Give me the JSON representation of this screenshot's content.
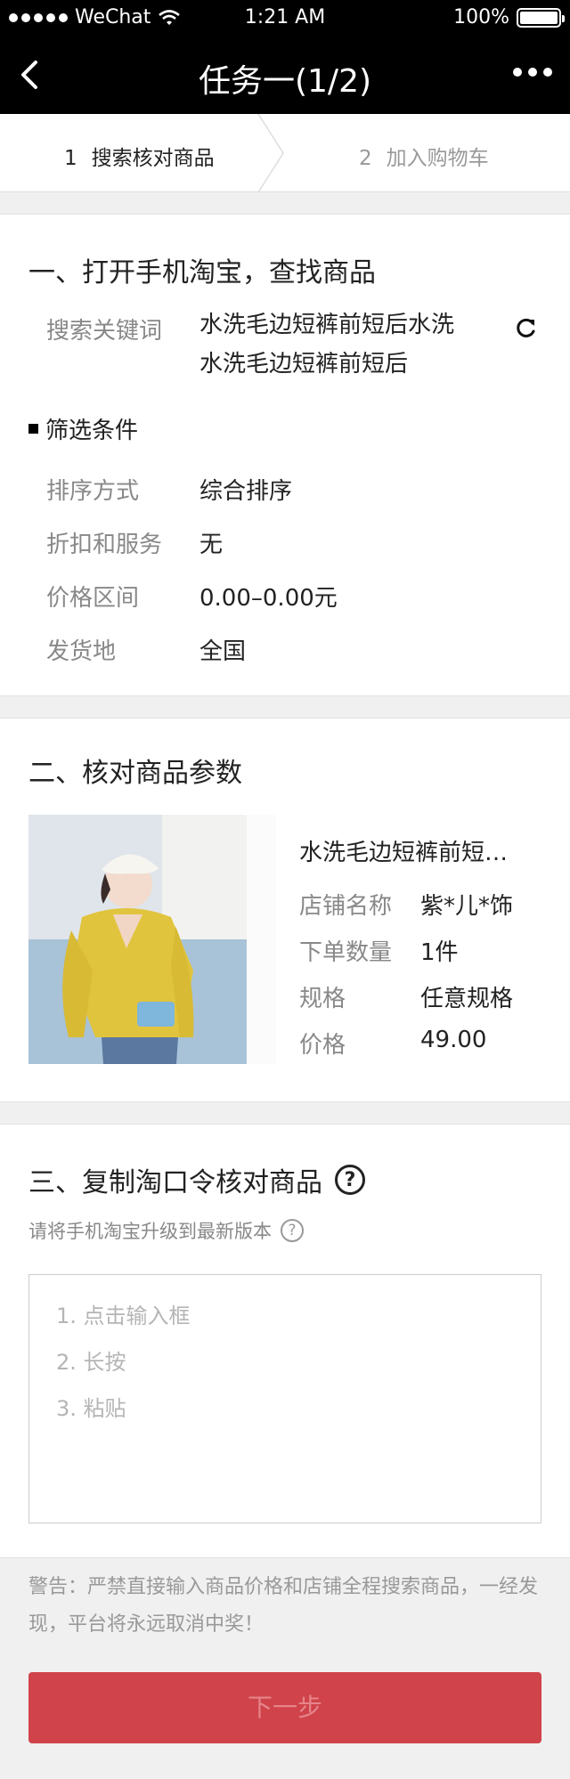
{
  "status_bar": {
    "carrier": "WeChat",
    "time": "1:21 AM",
    "battery": "100%"
  },
  "nav": {
    "title": "任务一(1/2)"
  },
  "steps": [
    {
      "num": "1",
      "label": "搜索核对商品",
      "active": true
    },
    {
      "num": "2",
      "label": "加入购物车",
      "active": false
    }
  ],
  "section1": {
    "title": "一、打开手机淘宝，查找商品",
    "keyword_label": "搜索关键词",
    "keyword_line1": "水洗毛边短裤前短后水洗",
    "keyword_line2": "水洗毛边短裤前短后",
    "filter_title": "筛选条件",
    "rows": [
      {
        "label": "排序方式",
        "value": "综合排序"
      },
      {
        "label": "折扣和服务",
        "value": "无"
      },
      {
        "label": "价格区间",
        "value": "0.00–0.00元"
      },
      {
        "label": "发货地",
        "value": "全国"
      }
    ]
  },
  "section2": {
    "title": "二、核对商品参数",
    "product_name": "水洗毛边短裤前短…",
    "params": [
      {
        "label": "店铺名称",
        "value": "紫*儿*饰"
      },
      {
        "label": "下单数量",
        "value": "1件"
      },
      {
        "label": "规格",
        "value": "任意规格"
      },
      {
        "label": "价格",
        "value": "49.00"
      }
    ]
  },
  "section3": {
    "title": "三、复制淘口令核对商品",
    "hint": "请将手机淘宝升级到最新版本",
    "placeholder_lines": [
      "1. 点击输入框",
      "2. 长按",
      "3. 粘贴"
    ]
  },
  "warning": "警告：严禁直接输入商品价格和店铺全程搜索商品，一经发现，平台将永远取消中奖！",
  "next_button": "下一步",
  "colors": {
    "button": "#d0434a",
    "button_text": "#e6848a",
    "nav_bg": "#000000"
  },
  "icons": {
    "back": "chevron-left-icon",
    "more": "more-dots-icon",
    "refresh": "refresh-icon",
    "help": "question-circle-icon"
  }
}
